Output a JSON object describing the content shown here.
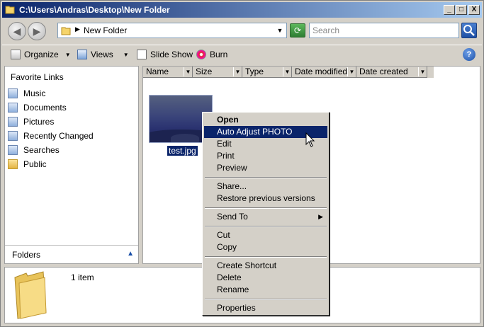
{
  "window": {
    "title": "C:\\Users\\Andras\\Desktop\\New Folder",
    "controls": [
      "_",
      "□",
      "X"
    ]
  },
  "address": {
    "path": "New Folder",
    "search_placeholder": "Search"
  },
  "toolbar": {
    "organize": "Organize",
    "views": "Views",
    "slideshow": "Slide Show",
    "burn": "Burn"
  },
  "sidebar": {
    "title": "Favorite Links",
    "items": [
      {
        "label": "Music",
        "icon": "music-icon"
      },
      {
        "label": "Documents",
        "icon": "documents-icon"
      },
      {
        "label": "Pictures",
        "icon": "pictures-icon"
      },
      {
        "label": "Recently Changed",
        "icon": "recently-changed-icon"
      },
      {
        "label": "Searches",
        "icon": "searches-icon"
      },
      {
        "label": "Public",
        "icon": "folder-icon"
      }
    ],
    "folders_label": "Folders"
  },
  "columns": [
    "Name",
    "Size",
    "Type",
    "Date modified",
    "Date created"
  ],
  "file": {
    "name": "test.jpg"
  },
  "details": {
    "count": "1 item"
  },
  "context_menu": {
    "items": [
      {
        "label": "Open",
        "bold": true
      },
      {
        "label": "Auto Adjust PHOTO",
        "highlighted": true
      },
      {
        "label": "Edit"
      },
      {
        "label": "Print"
      },
      {
        "label": "Preview"
      },
      {
        "separator": true
      },
      {
        "label": "Share..."
      },
      {
        "label": "Restore previous versions"
      },
      {
        "separator": true
      },
      {
        "label": "Send To",
        "submenu": true
      },
      {
        "separator": true
      },
      {
        "label": "Cut"
      },
      {
        "label": "Copy"
      },
      {
        "separator": true
      },
      {
        "label": "Create Shortcut"
      },
      {
        "label": "Delete"
      },
      {
        "label": "Rename"
      },
      {
        "separator": true
      },
      {
        "label": "Properties"
      }
    ]
  },
  "colors": {
    "title_start": "#0a246a",
    "title_end": "#a6caf0",
    "highlight": "#0a246a",
    "chrome": "#d4d0c8"
  }
}
